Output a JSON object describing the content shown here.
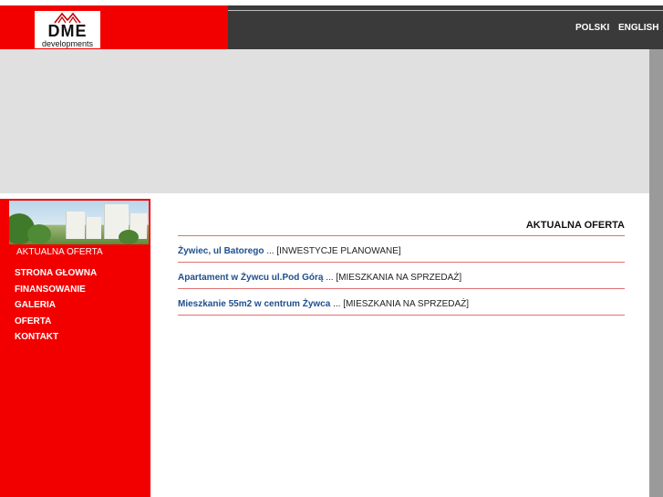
{
  "header": {
    "logo_text": "DME",
    "logo_subtext": "developments",
    "languages": [
      "POLSKI",
      "ENGLISH"
    ]
  },
  "sidebar": {
    "heading": "AKTUALNA OFERTA",
    "menu": [
      "STRONA GŁOWNA",
      "FINANSOWANIE",
      "GALERIA",
      "OFERTA",
      "KONTAKT"
    ]
  },
  "content": {
    "title": "AKTUALNA OFERTA",
    "offers": [
      {
        "name": "Żywiec, ul Batorego",
        "separator": " ... ",
        "category": "[INWESTYCJE PLANOWANE]"
      },
      {
        "name": "Apartament w Żywcu ul.Pod Górą",
        "separator": " ... ",
        "category": "[MIESZKANIA NA SPRZEDAŻ]"
      },
      {
        "name": "Mieszkanie 55m2 w centrum Żywca",
        "separator": " ... ",
        "category": "[MIESZKANIA NA SPRZEDAŻ]"
      }
    ]
  },
  "colors": {
    "brand_red": "#f20000",
    "header_dark": "#3a3a3a",
    "link_blue": "#1f4f8e",
    "rule_red": "#e07070"
  }
}
